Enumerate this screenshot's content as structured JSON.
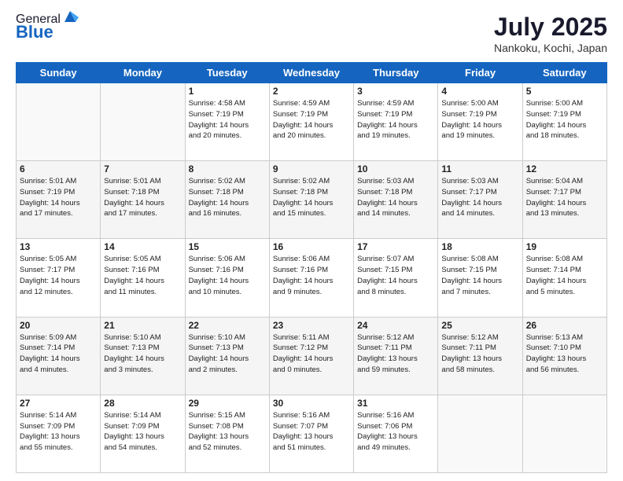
{
  "logo": {
    "general": "General",
    "blue": "Blue"
  },
  "title": "July 2025",
  "subtitle": "Nankoku, Kochi, Japan",
  "weekdays": [
    "Sunday",
    "Monday",
    "Tuesday",
    "Wednesday",
    "Thursday",
    "Friday",
    "Saturday"
  ],
  "weeks": [
    [
      {
        "day": "",
        "info": ""
      },
      {
        "day": "",
        "info": ""
      },
      {
        "day": "1",
        "info": "Sunrise: 4:58 AM\nSunset: 7:19 PM\nDaylight: 14 hours\nand 20 minutes."
      },
      {
        "day": "2",
        "info": "Sunrise: 4:59 AM\nSunset: 7:19 PM\nDaylight: 14 hours\nand 20 minutes."
      },
      {
        "day": "3",
        "info": "Sunrise: 4:59 AM\nSunset: 7:19 PM\nDaylight: 14 hours\nand 19 minutes."
      },
      {
        "day": "4",
        "info": "Sunrise: 5:00 AM\nSunset: 7:19 PM\nDaylight: 14 hours\nand 19 minutes."
      },
      {
        "day": "5",
        "info": "Sunrise: 5:00 AM\nSunset: 7:19 PM\nDaylight: 14 hours\nand 18 minutes."
      }
    ],
    [
      {
        "day": "6",
        "info": "Sunrise: 5:01 AM\nSunset: 7:19 PM\nDaylight: 14 hours\nand 17 minutes."
      },
      {
        "day": "7",
        "info": "Sunrise: 5:01 AM\nSunset: 7:18 PM\nDaylight: 14 hours\nand 17 minutes."
      },
      {
        "day": "8",
        "info": "Sunrise: 5:02 AM\nSunset: 7:18 PM\nDaylight: 14 hours\nand 16 minutes."
      },
      {
        "day": "9",
        "info": "Sunrise: 5:02 AM\nSunset: 7:18 PM\nDaylight: 14 hours\nand 15 minutes."
      },
      {
        "day": "10",
        "info": "Sunrise: 5:03 AM\nSunset: 7:18 PM\nDaylight: 14 hours\nand 14 minutes."
      },
      {
        "day": "11",
        "info": "Sunrise: 5:03 AM\nSunset: 7:17 PM\nDaylight: 14 hours\nand 14 minutes."
      },
      {
        "day": "12",
        "info": "Sunrise: 5:04 AM\nSunset: 7:17 PM\nDaylight: 14 hours\nand 13 minutes."
      }
    ],
    [
      {
        "day": "13",
        "info": "Sunrise: 5:05 AM\nSunset: 7:17 PM\nDaylight: 14 hours\nand 12 minutes."
      },
      {
        "day": "14",
        "info": "Sunrise: 5:05 AM\nSunset: 7:16 PM\nDaylight: 14 hours\nand 11 minutes."
      },
      {
        "day": "15",
        "info": "Sunrise: 5:06 AM\nSunset: 7:16 PM\nDaylight: 14 hours\nand 10 minutes."
      },
      {
        "day": "16",
        "info": "Sunrise: 5:06 AM\nSunset: 7:16 PM\nDaylight: 14 hours\nand 9 minutes."
      },
      {
        "day": "17",
        "info": "Sunrise: 5:07 AM\nSunset: 7:15 PM\nDaylight: 14 hours\nand 8 minutes."
      },
      {
        "day": "18",
        "info": "Sunrise: 5:08 AM\nSunset: 7:15 PM\nDaylight: 14 hours\nand 7 minutes."
      },
      {
        "day": "19",
        "info": "Sunrise: 5:08 AM\nSunset: 7:14 PM\nDaylight: 14 hours\nand 5 minutes."
      }
    ],
    [
      {
        "day": "20",
        "info": "Sunrise: 5:09 AM\nSunset: 7:14 PM\nDaylight: 14 hours\nand 4 minutes."
      },
      {
        "day": "21",
        "info": "Sunrise: 5:10 AM\nSunset: 7:13 PM\nDaylight: 14 hours\nand 3 minutes."
      },
      {
        "day": "22",
        "info": "Sunrise: 5:10 AM\nSunset: 7:13 PM\nDaylight: 14 hours\nand 2 minutes."
      },
      {
        "day": "23",
        "info": "Sunrise: 5:11 AM\nSunset: 7:12 PM\nDaylight: 14 hours\nand 0 minutes."
      },
      {
        "day": "24",
        "info": "Sunrise: 5:12 AM\nSunset: 7:11 PM\nDaylight: 13 hours\nand 59 minutes."
      },
      {
        "day": "25",
        "info": "Sunrise: 5:12 AM\nSunset: 7:11 PM\nDaylight: 13 hours\nand 58 minutes."
      },
      {
        "day": "26",
        "info": "Sunrise: 5:13 AM\nSunset: 7:10 PM\nDaylight: 13 hours\nand 56 minutes."
      }
    ],
    [
      {
        "day": "27",
        "info": "Sunrise: 5:14 AM\nSunset: 7:09 PM\nDaylight: 13 hours\nand 55 minutes."
      },
      {
        "day": "28",
        "info": "Sunrise: 5:14 AM\nSunset: 7:09 PM\nDaylight: 13 hours\nand 54 minutes."
      },
      {
        "day": "29",
        "info": "Sunrise: 5:15 AM\nSunset: 7:08 PM\nDaylight: 13 hours\nand 52 minutes."
      },
      {
        "day": "30",
        "info": "Sunrise: 5:16 AM\nSunset: 7:07 PM\nDaylight: 13 hours\nand 51 minutes."
      },
      {
        "day": "31",
        "info": "Sunrise: 5:16 AM\nSunset: 7:06 PM\nDaylight: 13 hours\nand 49 minutes."
      },
      {
        "day": "",
        "info": ""
      },
      {
        "day": "",
        "info": ""
      }
    ]
  ]
}
